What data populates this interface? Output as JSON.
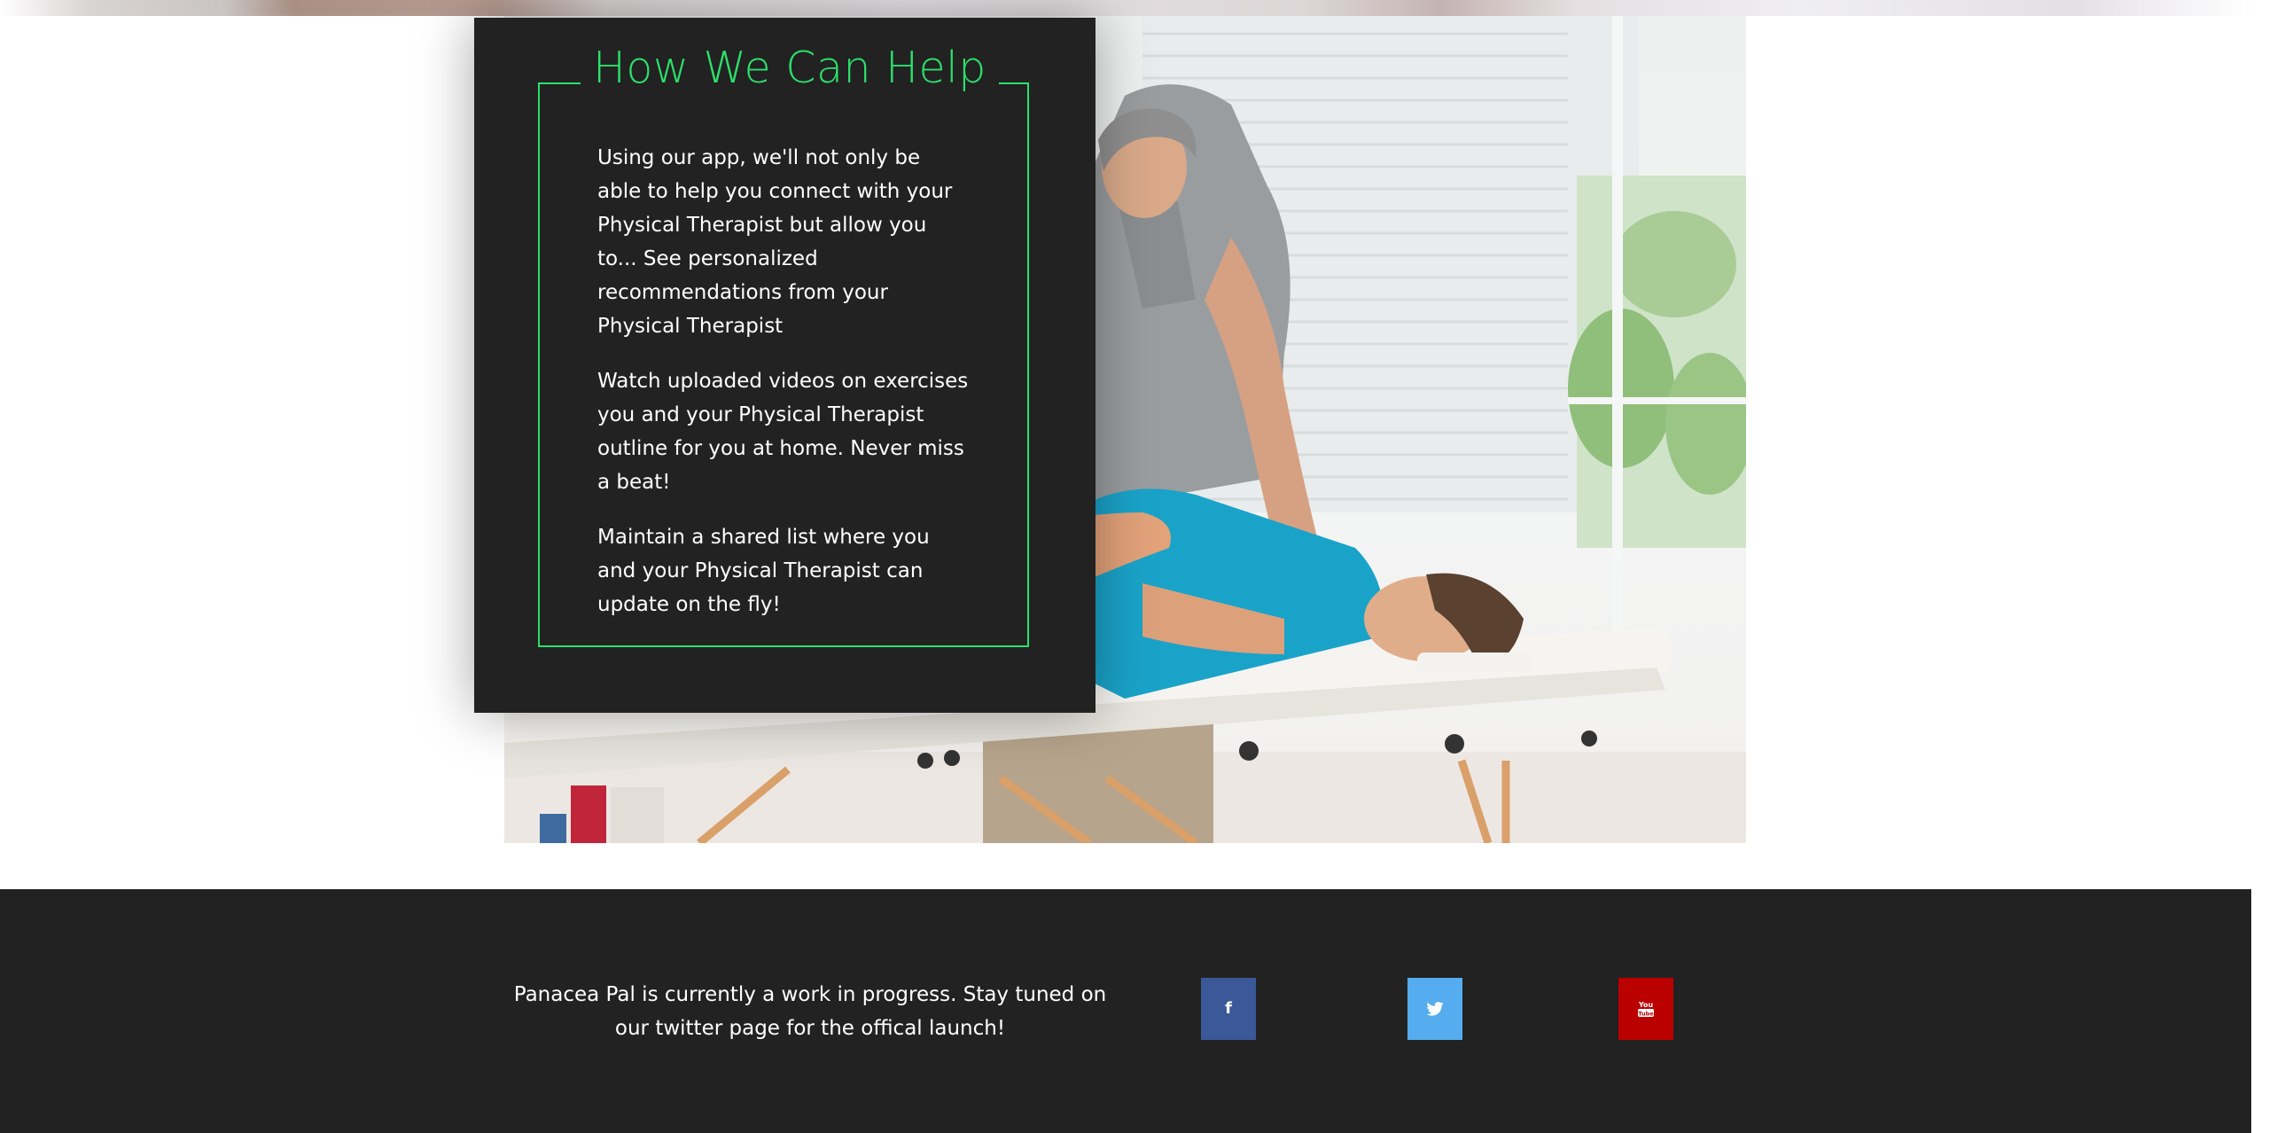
{
  "help_card": {
    "title": "How We Can Help",
    "paragraphs": [
      "Using our app, we'll not only be able to help you connect with your Physical Therapist but allow you to... See personalized recommendations from your Physical Therapist",
      "Watch uploaded videos on exercises you and your Physical Therapist outline for you at home. Never miss a beat!",
      "Maintain a shared list where you and your Physical Therapist can update on the fly!"
    ],
    "accent_color": "#2de06b",
    "background_color": "#222222"
  },
  "hero_image": {
    "description_icon": "physical-therapy-photo"
  },
  "footer": {
    "text": "Panacea Pal is currently a work in progress. Stay tuned on our twitter page for the offical launch!",
    "background_color": "#222222",
    "social": [
      {
        "name": "facebook",
        "icon": "facebook-icon",
        "glyph": "f",
        "color": "#3b5998"
      },
      {
        "name": "twitter",
        "icon": "twitter-icon",
        "glyph": "🐦",
        "color": "#55acee"
      },
      {
        "name": "youtube",
        "icon": "youtube-icon",
        "glyph": "You",
        "color": "#bb0000"
      }
    ]
  }
}
